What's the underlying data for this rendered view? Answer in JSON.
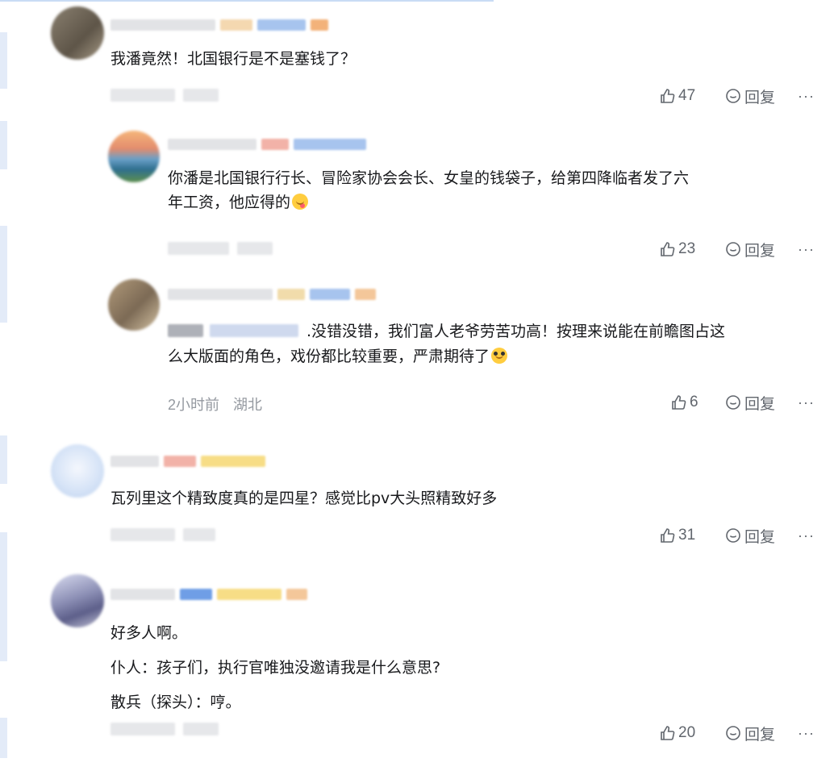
{
  "comments": [
    {
      "text": "我潘竟然！北国银行是不是塞钱了？",
      "likes": "47",
      "reply_label": "回复",
      "more_label": "···"
    },
    {
      "text_line1": "你潘是北国银行行长、冒险家协会会长、女皇的钱袋子，给第四降临者发了六",
      "text_line2": "年工资，他应得的",
      "likes": "23",
      "reply_label": "回复",
      "more_label": "···"
    },
    {
      "text_line1": ".没错没错，我们富人老爷劳苦功高！按理来说能在前瞻图占这",
      "text_line2": "么大版面的角色，戏份都比较重要，严肃期待了",
      "time": "2小时前",
      "location": "湖北",
      "likes": "6",
      "reply_label": "回复",
      "more_label": "···"
    },
    {
      "text": "瓦列里这个精致度真的是四星？感觉比pv大头照精致好多",
      "likes": "31",
      "reply_label": "回复",
      "more_label": "···"
    },
    {
      "line1": "好多人啊。",
      "line2": "仆人：孩子们，执行官唯独没邀请我是什么意思?",
      "line3": "散兵（探头）：哼。",
      "likes": "20",
      "reply_label": "回复",
      "more_label": "···"
    }
  ],
  "icons": {
    "like": "thumbs-up-icon",
    "reply": "reply-bubble-icon",
    "more": "more-dots-icon",
    "emoji_1": "tongue-emoji-icon",
    "emoji_2": "pleading-emoji-icon"
  },
  "colors": {
    "text": "#18191c",
    "meta": "#9499a0",
    "action": "#61666d",
    "rail": "#e3ebf8"
  }
}
